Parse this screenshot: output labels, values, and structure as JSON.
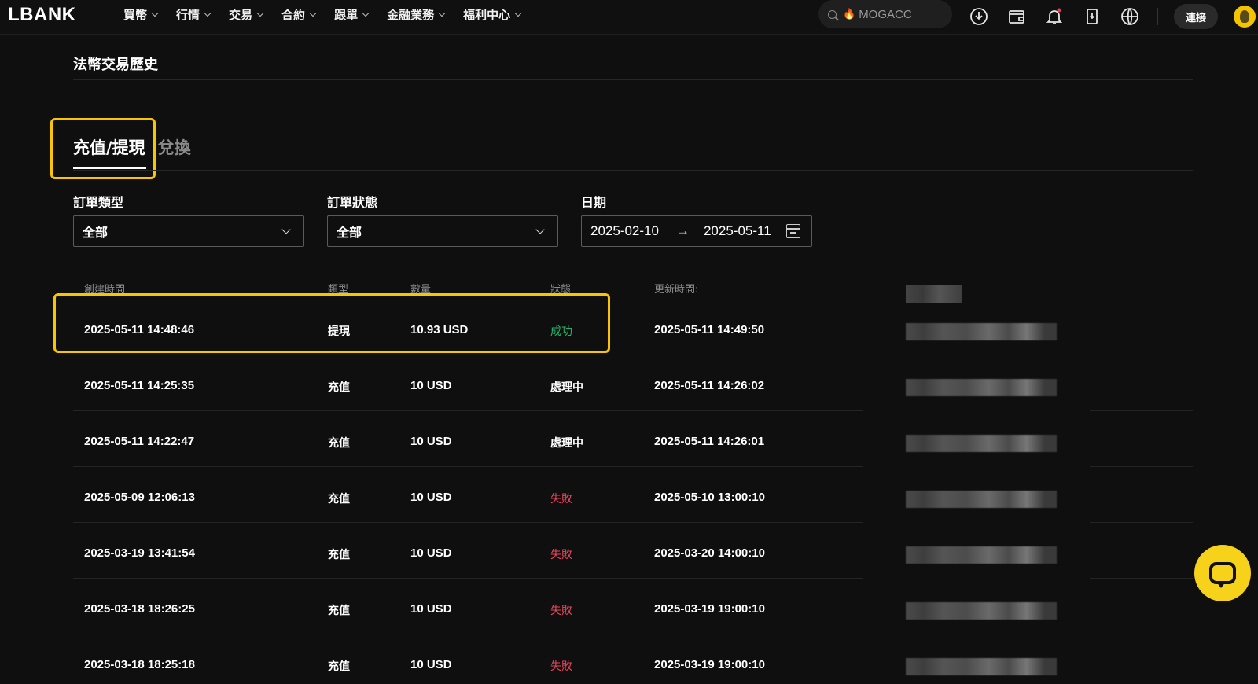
{
  "header": {
    "logo": "LBANK",
    "nav": [
      "買幣",
      "行情",
      "交易",
      "合約",
      "跟單",
      "金融業務",
      "福利中心"
    ],
    "search_placeholder": "MOGACC",
    "connect_label": "連接"
  },
  "page": {
    "title": "法幣交易歷史",
    "tabs": [
      {
        "label": "充值/提現",
        "active": true
      },
      {
        "label": "兌換",
        "active": false
      }
    ]
  },
  "filters": {
    "order_type": {
      "label": "訂單類型",
      "value": "全部"
    },
    "order_status": {
      "label": "訂單狀態",
      "value": "全部"
    },
    "date": {
      "label": "日期",
      "start": "2025-02-10",
      "end": "2025-05-11",
      "arrow": "→"
    }
  },
  "table": {
    "headers": {
      "created": "創建時間",
      "type": "類型",
      "amount": "數量",
      "status": "狀態",
      "updated": "更新時間:"
    },
    "rows": [
      {
        "created": "2025-05-11 14:48:46",
        "type": "提現",
        "amount": "10.93 USD",
        "status": "成功",
        "status_kind": "success",
        "updated": "2025-05-11 14:49:50"
      },
      {
        "created": "2025-05-11 14:25:35",
        "type": "充值",
        "amount": "10 USD",
        "status": "處理中",
        "status_kind": "processing",
        "updated": "2025-05-11 14:26:02"
      },
      {
        "created": "2025-05-11 14:22:47",
        "type": "充值",
        "amount": "10 USD",
        "status": "處理中",
        "status_kind": "processing",
        "updated": "2025-05-11 14:26:01"
      },
      {
        "created": "2025-05-09 12:06:13",
        "type": "充值",
        "amount": "10 USD",
        "status": "失敗",
        "status_kind": "failed",
        "updated": "2025-05-10 13:00:10"
      },
      {
        "created": "2025-03-19 13:41:54",
        "type": "充值",
        "amount": "10 USD",
        "status": "失敗",
        "status_kind": "failed",
        "updated": "2025-03-20 14:00:10"
      },
      {
        "created": "2025-03-18 18:26:25",
        "type": "充值",
        "amount": "10 USD",
        "status": "失敗",
        "status_kind": "failed",
        "updated": "2025-03-19 19:00:10"
      },
      {
        "created": "2025-03-18 18:25:18",
        "type": "充值",
        "amount": "10 USD",
        "status": "失敗",
        "status_kind": "failed",
        "updated": "2025-03-19 19:00:10"
      }
    ]
  },
  "colors": {
    "accent_highlight": "#f7c600",
    "success": "#21b56b",
    "failed": "#e8445a",
    "background": "#0f0f0f"
  },
  "icons": [
    "search-icon",
    "fire-icon",
    "download-icon",
    "wallet-icon",
    "bell-icon",
    "mobile-download-icon",
    "globe-icon",
    "chat-icon"
  ]
}
